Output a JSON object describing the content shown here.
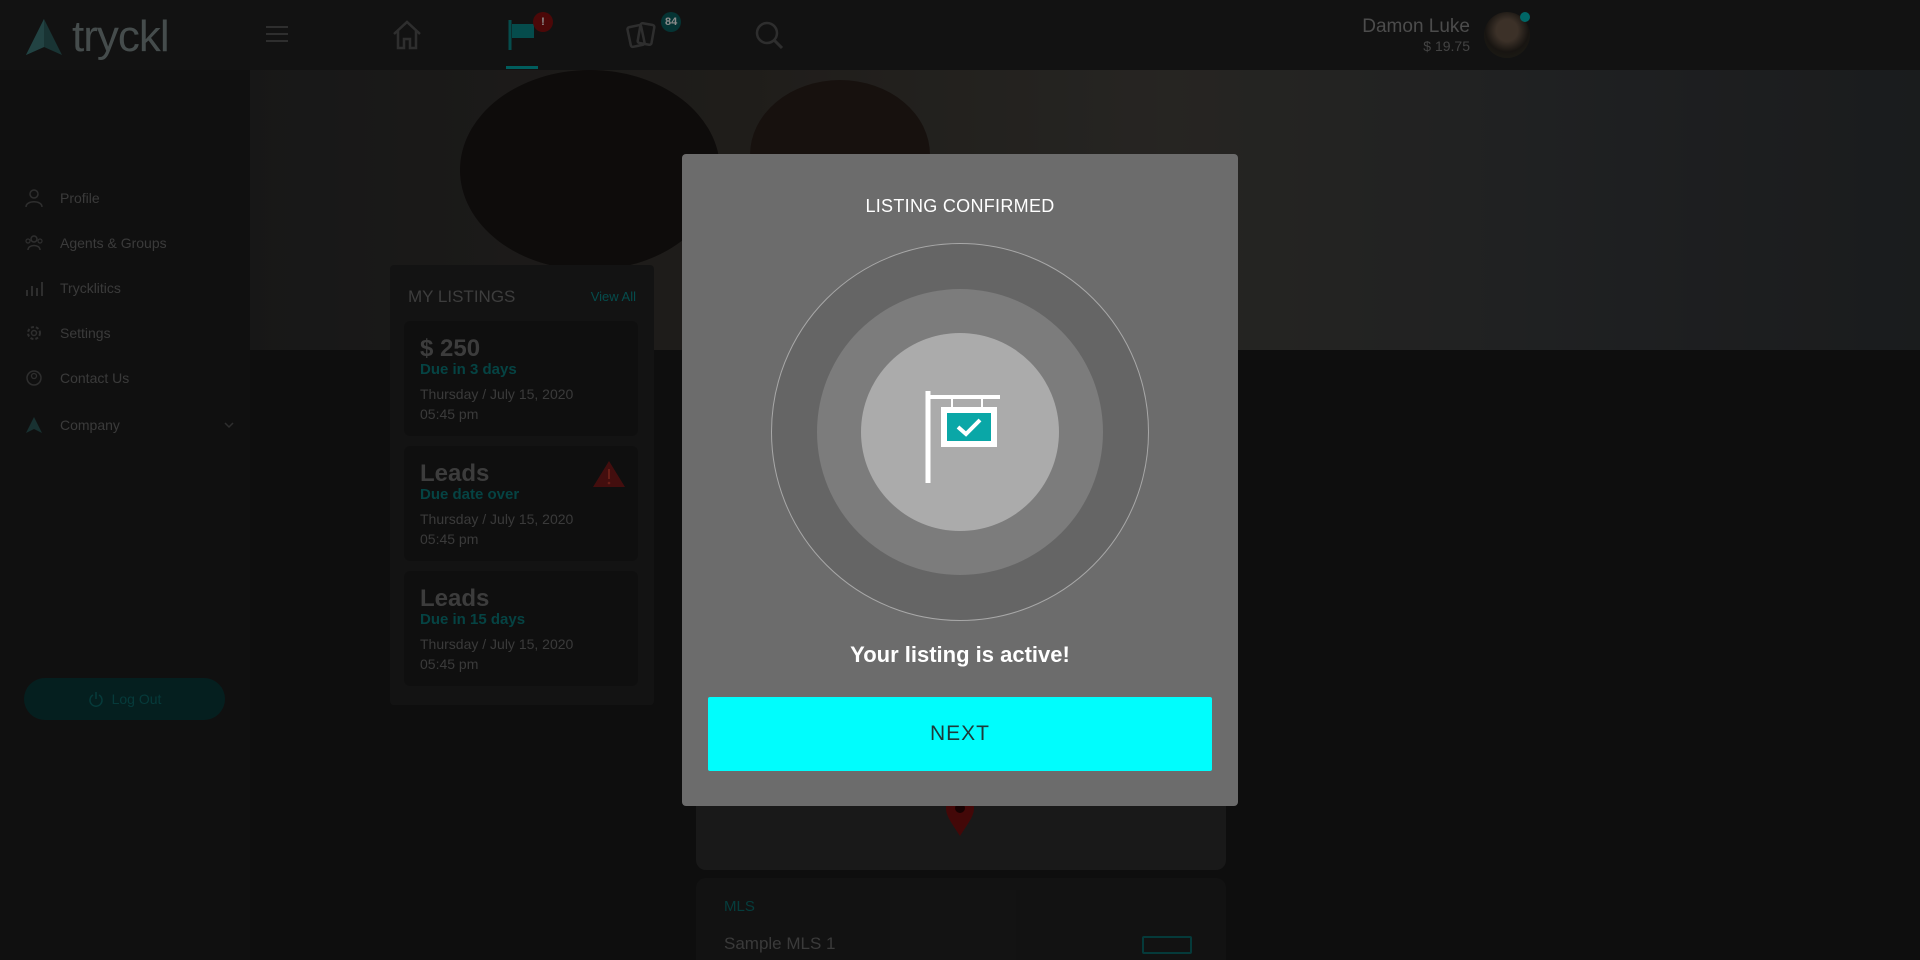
{
  "brand": {
    "logo_text": "tryckl"
  },
  "topbar": {
    "notifications_badge": "!",
    "cards_badge": "84",
    "user_name": "Damon Luke",
    "user_balance": "$ 19.75"
  },
  "sidebar": {
    "items": [
      {
        "label": "Profile",
        "icon": "user-icon"
      },
      {
        "label": "Agents & Groups",
        "icon": "group-icon"
      },
      {
        "label": "Trycklitics",
        "icon": "chart-icon"
      },
      {
        "label": "Settings",
        "icon": "gear-icon"
      },
      {
        "label": "Contact Us",
        "icon": "contact-icon"
      },
      {
        "label": "Company",
        "icon": "company-icon"
      }
    ],
    "logout_label": "Log Out"
  },
  "listings": {
    "title": "MY LISTINGS",
    "view_all": "View All",
    "cards": [
      {
        "title": "$ 250",
        "status": "Due in 3 days",
        "date": "Thursday / July 15, 2020",
        "time": "05:45 pm"
      },
      {
        "title": "Leads",
        "status": "Due date over",
        "date": "Thursday / July 15, 2020",
        "time": "05:45 pm"
      },
      {
        "title": "Leads",
        "status": "Due in 15 days",
        "date": "Thursday / July 15, 2020",
        "time": "05:45 pm"
      }
    ]
  },
  "mls": {
    "title": "MLS",
    "name": "Sample MLS 1"
  },
  "modal": {
    "title": "LISTING CONFIRMED",
    "message": "Your listing is active!",
    "next_label": "NEXT"
  },
  "colors": {
    "accent": "#00fdfd",
    "teal": "#0aa7a7",
    "alert": "#c0392b"
  }
}
